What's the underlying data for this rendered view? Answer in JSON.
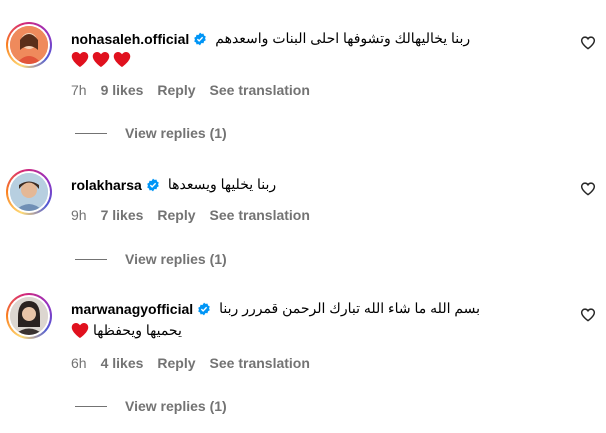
{
  "comments": [
    {
      "username": "nohasaleh.official",
      "text": "ربنا يخاليهالك وتشوفها احلى البنات واسعدهم",
      "second_line_hearts": 3,
      "time": "7h",
      "likes": "9 likes",
      "reply_label": "Reply",
      "translate_label": "See translation",
      "view_replies": "View replies (1)"
    },
    {
      "username": "rolakharsa",
      "text": "ربنا يخليها ويسعدها",
      "time": "9h",
      "likes": "7 likes",
      "reply_label": "Reply",
      "translate_label": "See translation",
      "view_replies": "View replies (1)"
    },
    {
      "username": "marwanagyofficial",
      "text": "بسم الله ما شاء الله تبارك الرحمن قمررر ربنا",
      "text2": "يحميها ويحفظها",
      "time": "6h",
      "likes": "4 likes",
      "reply_label": "Reply",
      "translate_label": "See translation",
      "view_replies": "View replies (1)"
    }
  ],
  "colors": {
    "verified": "#0095f6",
    "meta": "#737373",
    "heart_red": "#e0111e"
  }
}
